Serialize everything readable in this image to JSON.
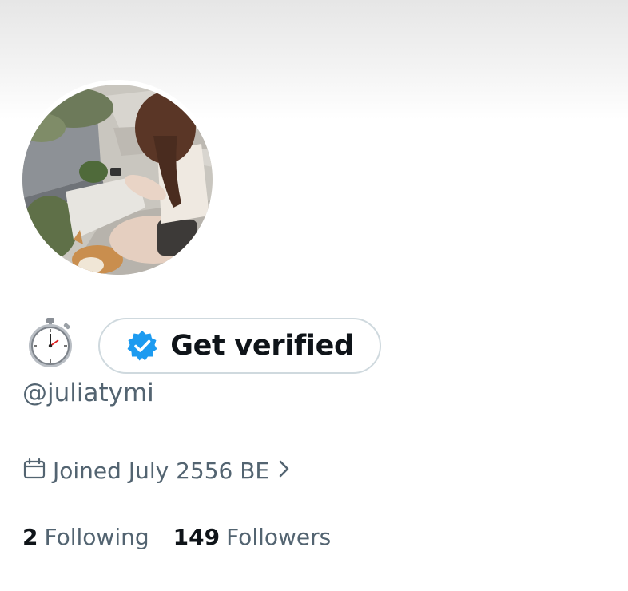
{
  "profile": {
    "handle": "@juliatymi",
    "avatar_icon": "profile-photo",
    "status_emoji": "stopwatch",
    "joined_icon": "calendar-icon",
    "joined_text": "Joined July 2556 BE",
    "joined_chevron": "chevron-right-icon"
  },
  "verify": {
    "label": "Get verified",
    "icon": "verified-badge-icon",
    "badge_color": "#1d9bf0"
  },
  "stats": {
    "following_count": "2",
    "following_label": "Following",
    "followers_count": "149",
    "followers_label": "Followers"
  },
  "colors": {
    "text_primary": "#0f1419",
    "text_secondary": "#536471",
    "border": "#cfd9de",
    "accent": "#1d9bf0"
  }
}
